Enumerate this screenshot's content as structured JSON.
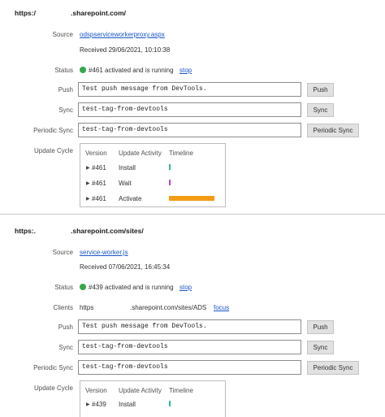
{
  "colors": {
    "running_dot": "#35a94a",
    "link": "#1a55c8",
    "install_tick": "#35b0a0",
    "wait_tick": "#c040c0",
    "activate_bar": "#f39c12"
  },
  "workers": [
    {
      "origin_prefix": "https:/",
      "origin_suffix": ".sharepoint.com/",
      "labels": {
        "source": "Source",
        "status": "Status",
        "push": "Push",
        "sync": "Sync",
        "periodic_sync": "Periodic Sync",
        "update_cycle": "Update Cycle"
      },
      "source_file": "odspserviceworkerproxy.aspx",
      "received": "Received 29/06/2021, 10:10:38",
      "status_text": "#461 activated and is running",
      "stop_link": "stop",
      "push_value": "Test push message from DevTools.",
      "push_button": "Push",
      "sync_value": "test-tag-from-devtools",
      "sync_button": "Sync",
      "periodic_value": "test-tag-from-devtools",
      "periodic_button": "Periodic Sync",
      "cycle_headers": {
        "version": "Version",
        "activity": "Update Activity",
        "timeline": "Timeline"
      },
      "cycle_rows": [
        {
          "version": "#461",
          "activity": "Install"
        },
        {
          "version": "#461",
          "activity": "Wait"
        },
        {
          "version": "#461",
          "activity": "Activate"
        }
      ]
    },
    {
      "origin_prefix": "https:.",
      "origin_suffix": ".sharepoint.com/sites/",
      "labels": {
        "source": "Source",
        "status": "Status",
        "clients": "Clients",
        "push": "Push",
        "sync": "Sync",
        "periodic_sync": "Periodic Sync",
        "update_cycle": "Update Cycle"
      },
      "source_file": "service-worker.js",
      "received": "Received 07/06/2021, 16:45:34",
      "status_text": "#439 activated and is running",
      "stop_link": "stop",
      "clients_prefix": "https",
      "clients_suffix": ".sharepoint.com/sites/ADS",
      "focus_link": "focus",
      "push_value": "Test push message from DevTools.",
      "push_button": "Push",
      "sync_value": "test-tag-from-devtools",
      "sync_button": "Sync",
      "periodic_value": "test-tag-from-devtools",
      "periodic_button": "Periodic Sync",
      "cycle_headers": {
        "version": "Version",
        "activity": "Update Activity",
        "timeline": "Timeline"
      },
      "cycle_rows": [
        {
          "version": "#439",
          "activity": "Install"
        }
      ]
    }
  ]
}
